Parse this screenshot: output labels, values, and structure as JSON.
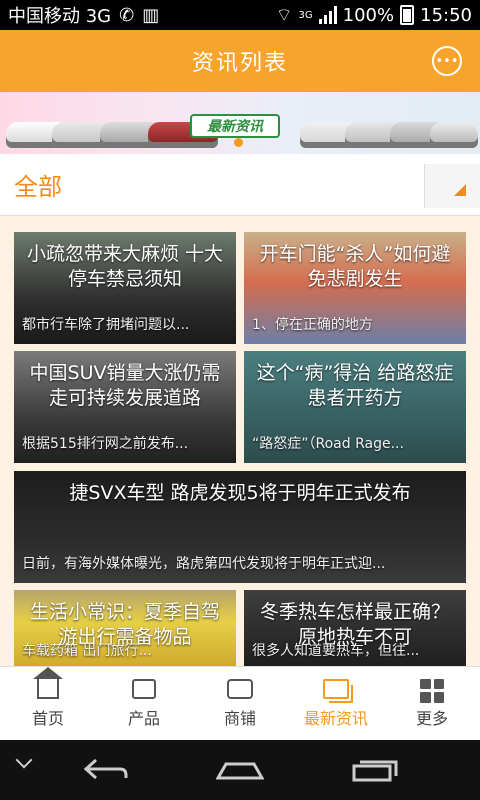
{
  "status_bar": {
    "carrier": "中国移动 3G",
    "network": "3G",
    "battery": "100%",
    "time": "15:50"
  },
  "app_bar": {
    "title": "资讯列表"
  },
  "banner": {
    "caption": "最新资讯"
  },
  "category": {
    "selected": "全部"
  },
  "news": [
    {
      "title": "小疏忽带来大麻烦 十大停车禁忌须知",
      "summary": "都市行车除了拥堵问题以..."
    },
    {
      "title": "开车门能“杀人”如何避免悲剧发生",
      "summary": "1、停在正确的地方"
    },
    {
      "title": "中国SUV销量大涨仍需走可持续发展道路",
      "summary": "根据515排行网之前发布..."
    },
    {
      "title": "这个“病”得治 给路怒症患者开药方",
      "summary": "“路怒症”（Road Rage..."
    },
    {
      "title": "捷SVX车型 路虎发现5将于明年正式发布",
      "summary": "日前，有海外媒体曝光，路虎第四代发现将于明年正式迎..."
    },
    {
      "title": "生活小常识：夏季自驾游出行需备物品",
      "summary": "车载药箱 出门旅行..."
    },
    {
      "title": "冬季热车怎样最正确？原地热车不可",
      "summary": "很多人知道要热车，但往..."
    }
  ],
  "bottom_nav": [
    {
      "label": "首页",
      "icon": "home-icon"
    },
    {
      "label": "产品",
      "icon": "shirt-icon"
    },
    {
      "label": "商铺",
      "icon": "shop-icon"
    },
    {
      "label": "最新资讯",
      "icon": "news-icon",
      "active": true
    },
    {
      "label": "更多",
      "icon": "grid-icon"
    }
  ],
  "colors": {
    "brand_orange": "#f7a42c",
    "active_orange": "#f39a1f",
    "content_bg": "#fdf2e1"
  }
}
